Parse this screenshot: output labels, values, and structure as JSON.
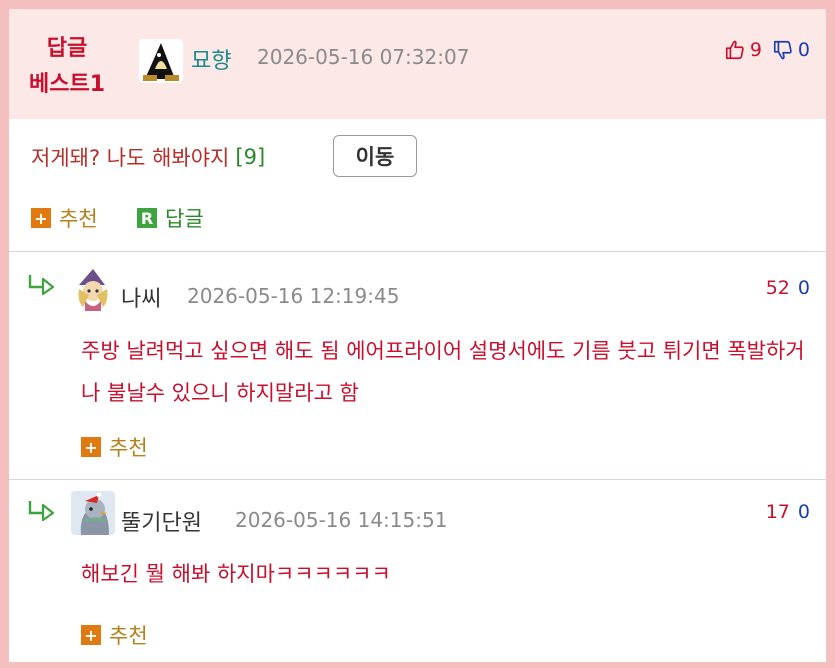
{
  "post": {
    "best_label_line1": "답글",
    "best_label_line2": "베스트1",
    "author": "묘향",
    "date": "2026-05-16 07:32:07",
    "upvotes": "9",
    "downvotes": "0",
    "content": "저게돼? 나도 해봐야지",
    "reply_count": "[9]",
    "move_label": "이동",
    "recommend_label": "추천",
    "reply_label": "답글",
    "recommend_icon_glyph": "+",
    "reply_icon_glyph": "R"
  },
  "comments": [
    {
      "author": "나씨",
      "date": "2026-05-16 12:19:45",
      "upvotes": "52",
      "downvotes": "0",
      "text": "주방 날려먹고 싶으면 해도 됨 에어프라이어 설명서에도 기름 붓고 튀기면 폭발하거나 불날수 있으니 하지말라고 함",
      "recommend_label": "추천",
      "recommend_icon_glyph": "+"
    },
    {
      "author": "뚤기단원",
      "date": "2026-05-16 14:15:51",
      "upvotes": "17",
      "downvotes": "0",
      "text": "해보긴 뭘 해봐 하지마ㅋㅋㅋㅋㅋㅋ",
      "recommend_label": "추천",
      "recommend_icon_glyph": "+"
    }
  ],
  "colors": {
    "best_red": "#c8102e",
    "header_bg": "#fde8e8",
    "nick_teal": "#1a8a8a",
    "vote_blue": "#1a3fa8",
    "action_orange": "#e07a10",
    "reply_green": "#3fa33f"
  },
  "icons": {
    "upvote": "thumbs-up-icon",
    "downvote": "thumbs-down-icon",
    "reply_arrow": "reply-arrow-icon",
    "recommend": "plus-box-icon",
    "reply": "r-box-icon"
  }
}
